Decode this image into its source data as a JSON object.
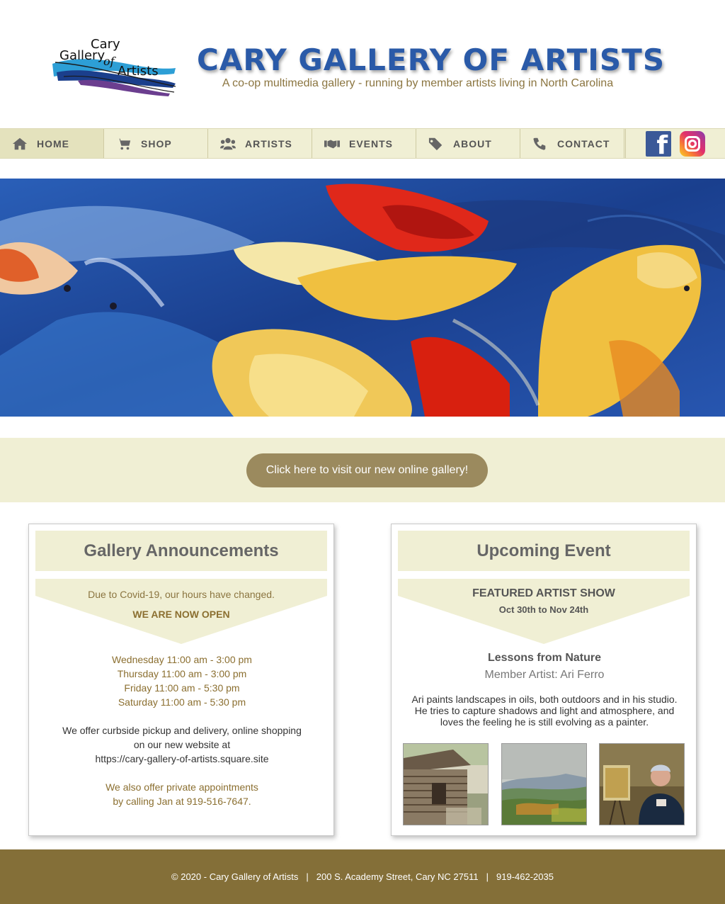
{
  "header": {
    "logo_text": "Cary Gallery of Artists",
    "title": "CARY GALLERY OF ARTISTS",
    "tagline": "A co-op multimedia gallery - running by member artists living in North Carolina"
  },
  "nav": {
    "items": [
      {
        "label": "HOME",
        "icon": "home-icon",
        "active": true
      },
      {
        "label": "SHOP",
        "icon": "cart-icon",
        "active": false
      },
      {
        "label": "ARTISTS",
        "icon": "users-icon",
        "active": false
      },
      {
        "label": "EVENTS",
        "icon": "handshake-icon",
        "active": false
      },
      {
        "label": "ABOUT",
        "icon": "tags-icon",
        "active": false
      },
      {
        "label": "CONTACT",
        "icon": "phone-icon",
        "active": false
      }
    ],
    "social": [
      "facebook-icon",
      "instagram-icon"
    ]
  },
  "hero": {
    "image": "koi-fish-painting"
  },
  "cta": {
    "label": "Click here to visit our new online gallery!"
  },
  "announcements": {
    "title": "Gallery Announcements",
    "notice": "Due to Covid-19, our hours have changed.",
    "status": "WE ARE NOW OPEN",
    "hours": [
      "Wednesday 11:00 am - 3:00 pm",
      "Thursday 11:00 am - 3:00 pm",
      "Friday 11:00 am - 5:30 pm",
      "Saturday 11:00 am - 5:30 pm"
    ],
    "curbside": [
      "We offer curbside pickup and delivery, online shopping",
      "on our new website at",
      "https://cary-gallery-of-artists.square.site"
    ],
    "appointments": [
      "We also offer private appointments",
      "by calling Jan at 919-516-7647."
    ]
  },
  "event": {
    "title": "Upcoming Event",
    "show": "FEATURED ARTIST SHOW",
    "dates": "Oct 30th to Nov 24th",
    "exhibit": "Lessons from Nature",
    "member": "Member Artist: Ari Ferro",
    "description": "Ari paints landscapes in oils, both outdoors and in his studio. He tries to capture shadows and light and atmosphere, and loves the feeling he is still evolving as a painter.",
    "thumbnails": [
      "cabin-painting",
      "mountain-landscape-painting",
      "artist-portrait-photo"
    ]
  },
  "footer": {
    "copyright": "© 2020 - Cary Gallery of Artists",
    "address": "200 S. Academy Street, Cary NC 27511",
    "phone": "919-462-2035"
  },
  "colors": {
    "title_blue": "#2a5aa8",
    "gold_text": "#8b6f30",
    "cream": "#f0efd4",
    "button": "#9b8a5e",
    "footer": "#846f38"
  }
}
